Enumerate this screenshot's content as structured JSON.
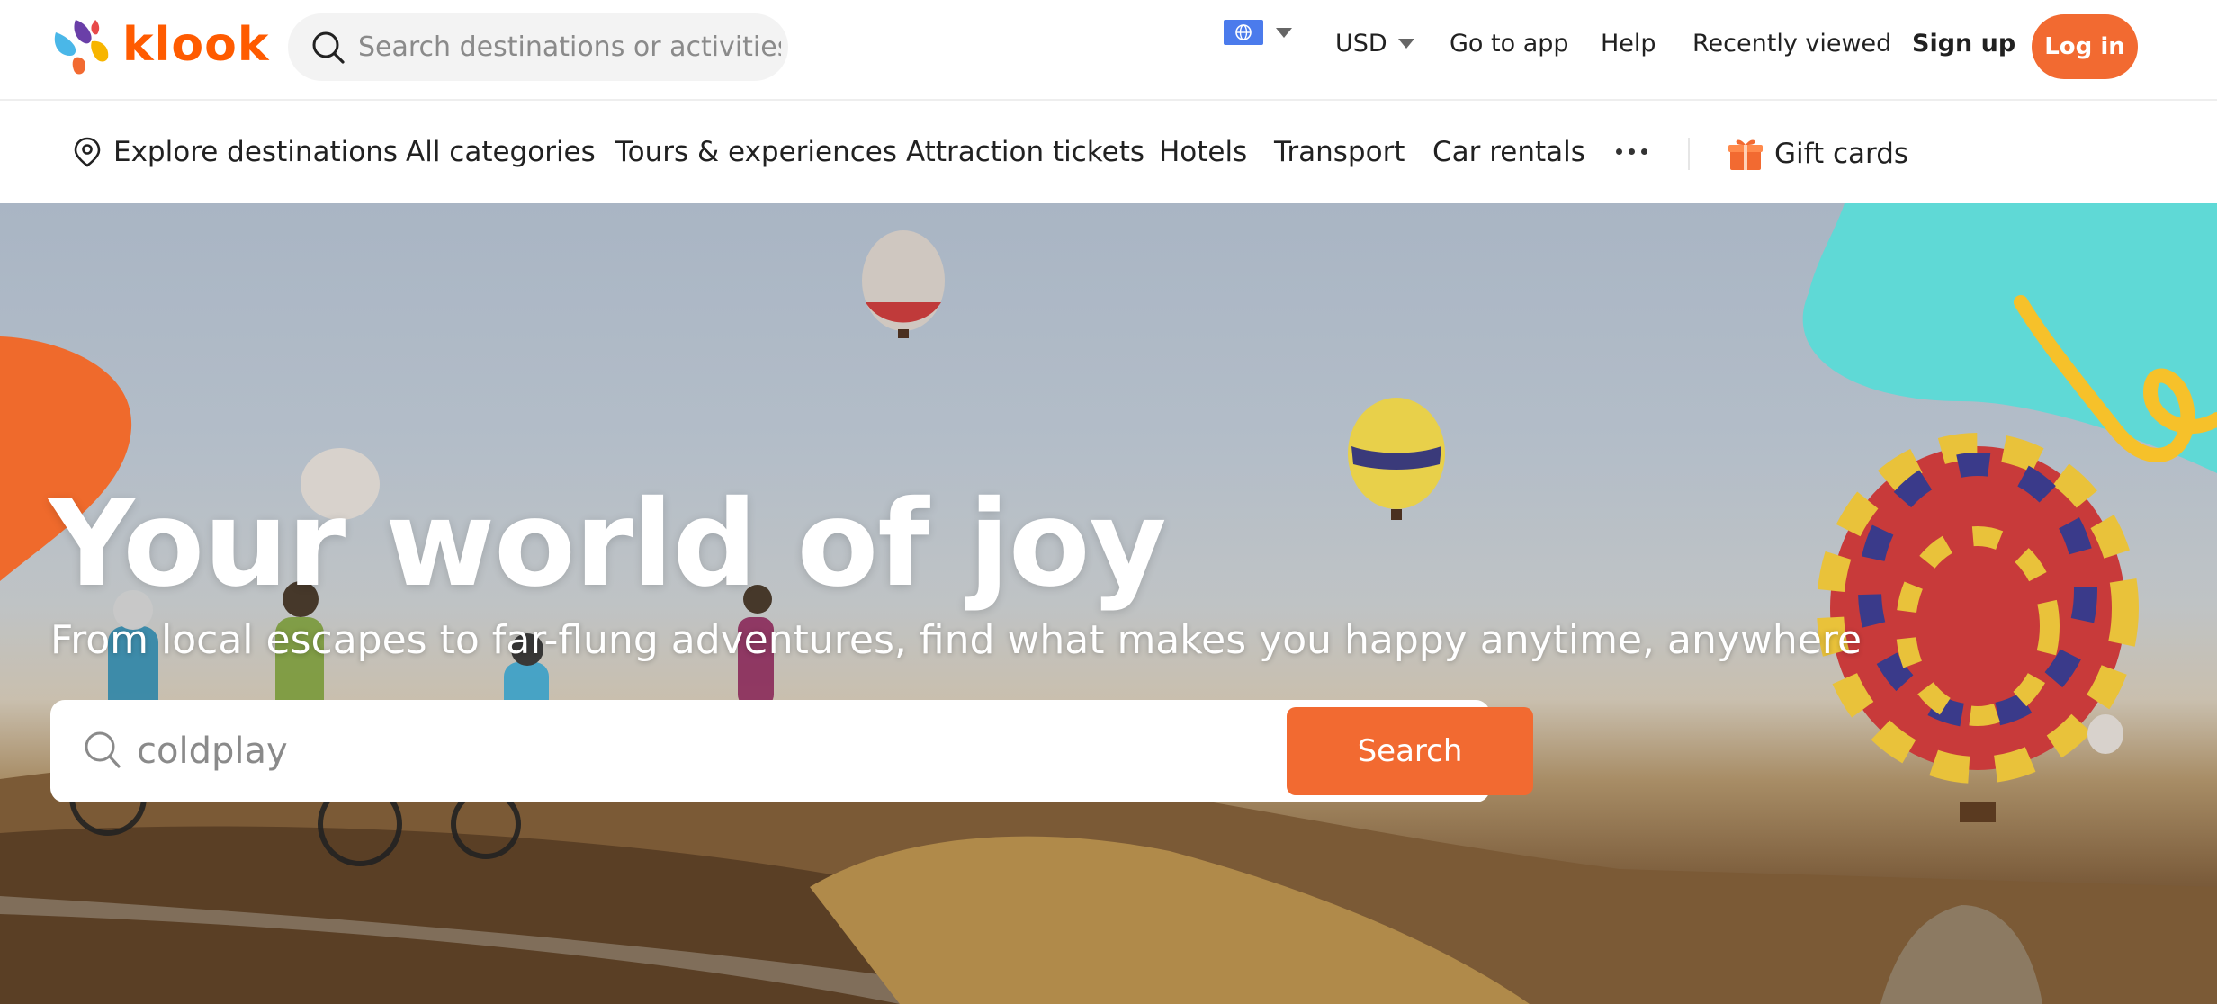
{
  "brand": {
    "name": "klook",
    "accent_color": "#f26a31"
  },
  "header": {
    "search_placeholder": "Search destinations or activities",
    "language_icon": "globe-icon",
    "currency": "USD",
    "links": {
      "go_to_app": "Go to app",
      "help": "Help",
      "recently_viewed": "Recently viewed",
      "sign_up": "Sign up"
    },
    "login_label": "Log in"
  },
  "nav": {
    "explore": "Explore destinations",
    "categories": [
      "All categories",
      "Tours & experiences",
      "Attraction tickets",
      "Hotels",
      "Transport",
      "Car rentals"
    ],
    "more_icon": "more-dots-icon",
    "gift_cards": "Gift cards"
  },
  "hero": {
    "title": "Your world of joy",
    "subtitle": "From local escapes to far-flung adventures, find what makes you happy anytime, anywhere",
    "search_value": "coldplay",
    "search_button": "Search"
  }
}
